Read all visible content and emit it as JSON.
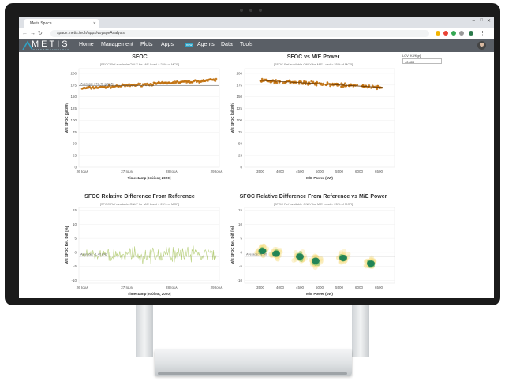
{
  "browser": {
    "tab_title": "Metis Space",
    "url": "space.metis.tech/apps/voyageAnalysis"
  },
  "nav": {
    "logo_text": "METIS",
    "logo_subtext": "CYBERTECHNOLOGY",
    "items": [
      {
        "label": "Home"
      },
      {
        "label": "Management"
      },
      {
        "label": "Plots"
      },
      {
        "label": "Apps"
      },
      {
        "label": "Agents"
      },
      {
        "label": "Data"
      },
      {
        "label": "Tools"
      }
    ],
    "apps_badge": "new"
  },
  "lcv": {
    "label": "LCV [KJ/Kgr]",
    "value": "40.800"
  },
  "colors": {
    "sfoc_points": "#c06d08",
    "sfoc_line": "#6b3b06",
    "diff_line": "#b7cf7a",
    "heat_core": "#0f7a52",
    "heat_outer": "#f5e08a"
  },
  "chart_data": [
    {
      "type": "scatter",
      "title": "SFOC",
      "subtitle": "[SFOC Ref available ONLY for M/E Load > 25% of MCR]",
      "xlabel": "Timestamp [Ιούλιος 2020]",
      "ylabel": "M/E SFOC [g/kWh]",
      "x_ticks": [
        "26 Ιουλ",
        "27 Ιουλ",
        "28 Ιουλ",
        "29 Ιουλ"
      ],
      "y_ticks": [
        0,
        25,
        50,
        75,
        100,
        125,
        150,
        175,
        200
      ],
      "ylim": [
        0,
        210
      ],
      "average_label": "Average: 173.46 g/kWh",
      "average": 173.46,
      "points_start": 168,
      "points_end": 186
    },
    {
      "type": "scatter",
      "title": "SFOC vs M/E Power",
      "subtitle": "[SFOC Ref available ONLY for M/E Load > 25% of MCR]",
      "xlabel": "M/E Power (kW)",
      "ylabel": "M/E SFOC [g/kWh]",
      "x_ticks": [
        3500,
        4000,
        4500,
        5000,
        5500,
        6000,
        6500
      ],
      "xlim": [
        3100,
        6900
      ],
      "y_ticks": [
        0,
        25,
        50,
        75,
        100,
        125,
        150,
        175,
        200
      ],
      "ylim": [
        0,
        210
      ],
      "fit_start": 185,
      "fit_end": 170
    },
    {
      "type": "line",
      "title": "SFOC Relative Difference From Reference",
      "subtitle": "[SFOC Ref available ONLY for M/E Load > 25% of MCR]",
      "xlabel": "Timestamp [Ιούλιος 2020]",
      "ylabel": "M/E SFOC Ref. Diff [%]",
      "x_ticks": [
        "26 Ιουλ",
        "27 Ιουλ",
        "28 Ιουλ",
        "29 Ιουλ"
      ],
      "y_ticks": [
        -10,
        -5,
        0,
        5,
        10,
        15
      ],
      "ylim": [
        -11,
        16
      ],
      "average_label": "Average: -1.40 (%)",
      "average": -1.4
    },
    {
      "type": "heatmap",
      "title": "SFOC Relative Difference From Reference vs M/E Power",
      "subtitle": "[SFOC Ref available ONLY for M/E Load > 25% of MCR]",
      "xlabel": "M/E Power (kW)",
      "ylabel": "M/E SFOC Ref. Diff [%]",
      "x_ticks": [
        3500,
        4000,
        4500,
        5000,
        5500,
        6000,
        6500
      ],
      "xlim": [
        3100,
        6900
      ],
      "y_ticks": [
        -10,
        -5,
        0,
        5,
        10,
        15
      ],
      "ylim": [
        -11,
        16
      ],
      "average_label": "Average: -1.40",
      "average": -1.4,
      "clusters": [
        {
          "x": 3550,
          "y": 0.5
        },
        {
          "x": 3900,
          "y": -0.5
        },
        {
          "x": 4500,
          "y": -1.5
        },
        {
          "x": 4900,
          "y": -3
        },
        {
          "x": 5600,
          "y": -2
        },
        {
          "x": 6300,
          "y": -4
        }
      ]
    }
  ]
}
